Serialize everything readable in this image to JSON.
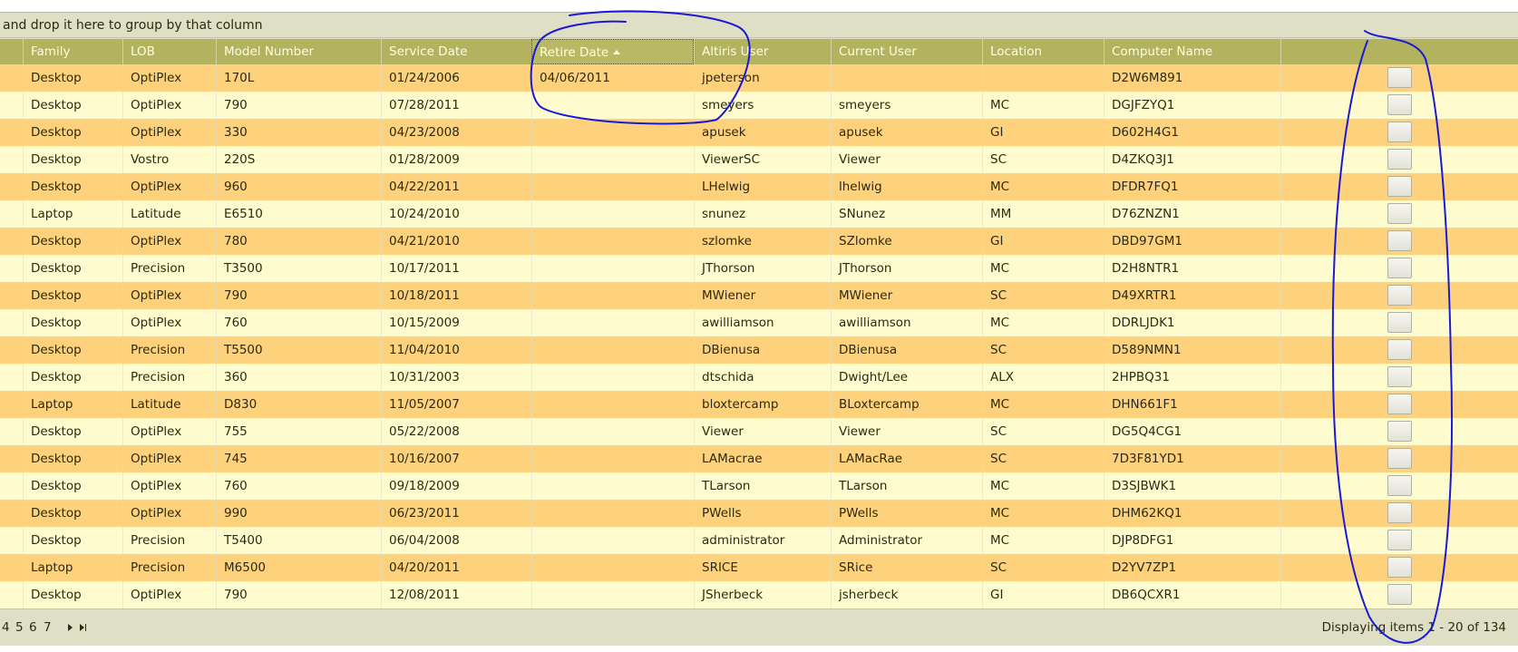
{
  "group_bar": {
    "text": "and drop it here to group by that column"
  },
  "columns": [
    {
      "key": "family",
      "label": "Family"
    },
    {
      "key": "lob",
      "label": "LOB"
    },
    {
      "key": "model",
      "label": "Model Number"
    },
    {
      "key": "service_date",
      "label": "Service Date"
    },
    {
      "key": "retire_date",
      "label": "Retire Date",
      "sorted": "ascending"
    },
    {
      "key": "altiris_user",
      "label": "Altiris User"
    },
    {
      "key": "current_user",
      "label": "Current User"
    },
    {
      "key": "location",
      "label": "Location"
    },
    {
      "key": "computer_name",
      "label": "Computer Name"
    }
  ],
  "rows": [
    [
      "Desktop",
      "OptiPlex",
      "170L",
      "01/24/2006",
      "04/06/2011",
      "jpeterson",
      "",
      "",
      "D2W6M891"
    ],
    [
      "Desktop",
      "OptiPlex",
      "790",
      "07/28/2011",
      "",
      "smeyers",
      "smeyers",
      "MC",
      "DGJFZYQ1"
    ],
    [
      "Desktop",
      "OptiPlex",
      "330",
      "04/23/2008",
      "",
      "apusek",
      "apusek",
      "GI",
      "D602H4G1"
    ],
    [
      "Desktop",
      "Vostro",
      "220S",
      "01/28/2009",
      "",
      "ViewerSC",
      "Viewer",
      "SC",
      "D4ZKQ3J1"
    ],
    [
      "Desktop",
      "OptiPlex",
      "960",
      "04/22/2011",
      "",
      "LHelwig",
      "lhelwig",
      "MC",
      "DFDR7FQ1"
    ],
    [
      "Laptop",
      "Latitude",
      "E6510",
      "10/24/2010",
      "",
      "snunez",
      "SNunez",
      "MM",
      "D76ZNZN1"
    ],
    [
      "Desktop",
      "OptiPlex",
      "780",
      "04/21/2010",
      "",
      "szlomke",
      "SZlomke",
      "GI",
      "DBD97GM1"
    ],
    [
      "Desktop",
      "Precision",
      "T3500",
      "10/17/2011",
      "",
      "JThorson",
      "JThorson",
      "MC",
      "D2H8NTR1"
    ],
    [
      "Desktop",
      "OptiPlex",
      "790",
      "10/18/2011",
      "",
      "MWiener",
      "MWiener",
      "SC",
      "D49XRTR1"
    ],
    [
      "Desktop",
      "OptiPlex",
      "760",
      "10/15/2009",
      "",
      "awilliamson",
      "awilliamson",
      "MC",
      "DDRLJDK1"
    ],
    [
      "Desktop",
      "Precision",
      "T5500",
      "11/04/2010",
      "",
      "DBienusa",
      "DBienusa",
      "SC",
      "D589NMN1"
    ],
    [
      "Desktop",
      "Precision",
      "360",
      "10/31/2003",
      "",
      "dtschida",
      "Dwight/Lee",
      "ALX",
      "2HPBQ31"
    ],
    [
      "Laptop",
      "Latitude",
      "D830",
      "11/05/2007",
      "",
      "bloxtercamp",
      "BLoxtercamp",
      "MC",
      "DHN661F1"
    ],
    [
      "Desktop",
      "OptiPlex",
      "755",
      "05/22/2008",
      "",
      "Viewer",
      "Viewer",
      "SC",
      "DG5Q4CG1"
    ],
    [
      "Desktop",
      "OptiPlex",
      "745",
      "10/16/2007",
      "",
      "LAMacrae",
      "LAMacRae",
      "SC",
      "7D3F81YD1"
    ],
    [
      "Desktop",
      "OptiPlex",
      "760",
      "09/18/2009",
      "",
      "TLarson",
      "TLarson",
      "MC",
      "D3SJBWK1"
    ],
    [
      "Desktop",
      "OptiPlex",
      "990",
      "06/23/2011",
      "",
      "PWells",
      "PWells",
      "MC",
      "DHM62KQ1"
    ],
    [
      "Desktop",
      "Precision",
      "T5400",
      "06/04/2008",
      "",
      "administrator",
      "Administrator",
      "MC",
      "DJP8DFG1"
    ],
    [
      "Laptop",
      "Precision",
      "M6500",
      "04/20/2011",
      "",
      "SRICE",
      "SRice",
      "SC",
      "D2YV7ZP1"
    ],
    [
      "Desktop",
      "OptiPlex",
      "790",
      "12/08/2011",
      "",
      "JSherbeck",
      "jsherbeck",
      "GI",
      "DB6QCXR1"
    ]
  ],
  "pager": {
    "pages": [
      "4",
      "5",
      "6",
      "7"
    ],
    "info": "Displaying items 1 - 20 of 134"
  },
  "colors": {
    "header_bg": "#b3b25e",
    "row_odd": "#fed17c",
    "row_even": "#fefccf",
    "toolbar_bg": "#dfdfc6",
    "annotation_ink": "#1a1ad6"
  },
  "icons": [
    "sort-ascending-icon",
    "next-page-icon",
    "last-page-icon"
  ]
}
